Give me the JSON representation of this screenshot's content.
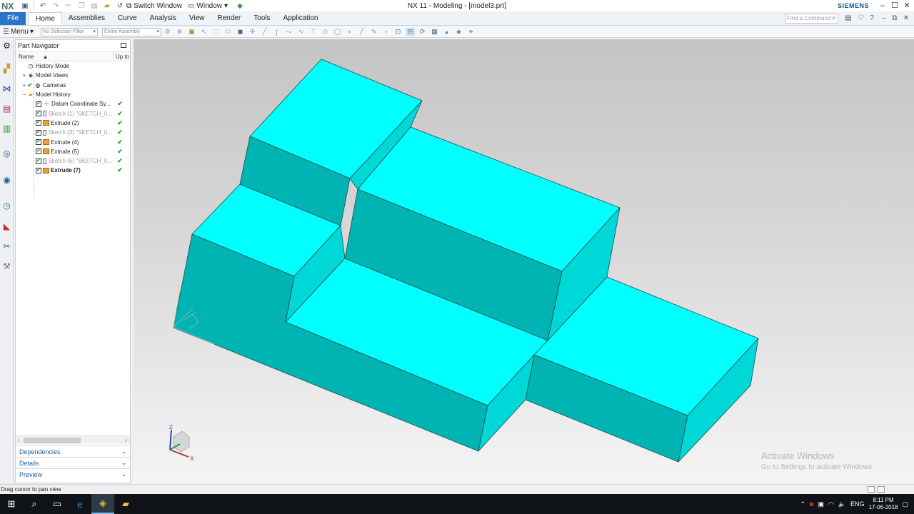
{
  "app": {
    "logo": "NX",
    "window_title": "NX 11 - Modeling - [model3.prt]",
    "brand": "SIEMENS",
    "switch_window": "Switch Window",
    "window_menu": "Window"
  },
  "ribbon": {
    "tabs": [
      "File",
      "Home",
      "Assemblies",
      "Curve",
      "Analysis",
      "View",
      "Render",
      "Tools",
      "Application"
    ],
    "active_tab": "Home",
    "find_placeholder": "Find a Command"
  },
  "toolbar": {
    "menu_label": "Menu",
    "selection_filter": "No Selection Filter",
    "scope": "Entire Assembly"
  },
  "part_navigator": {
    "title": "Part Navigator",
    "columns": {
      "name": "Name",
      "up_to_date": "Up to"
    },
    "nodes": [
      {
        "label": "History Mode",
        "icon": "clock-icon",
        "expander": "",
        "checked": false,
        "status": "",
        "style": "normal"
      },
      {
        "label": "Model Views",
        "icon": "views-icon",
        "expander": "+",
        "checked": false,
        "status": "",
        "style": "normal"
      },
      {
        "label": "Cameras",
        "icon": "camera-icon",
        "expander": "+",
        "checked": true,
        "status": "",
        "style": "normal"
      },
      {
        "label": "Model History",
        "icon": "folder-icon",
        "expander": "−",
        "checked": false,
        "status": "",
        "style": "normal"
      },
      {
        "label": "Datum Coordinate Sy...",
        "icon": "datum-icon",
        "expander": "",
        "checked": true,
        "status": "✔",
        "style": "normal"
      },
      {
        "label": "Sketch (1) \"SKETCH_0...",
        "icon": "sketch-icon",
        "expander": "",
        "checked": true,
        "status": "✔",
        "style": "dim"
      },
      {
        "label": "Extrude (2)",
        "icon": "extrude-icon",
        "expander": "",
        "checked": true,
        "status": "✔",
        "style": "normal"
      },
      {
        "label": "Sketch (3) \"SKETCH_0...",
        "icon": "sketch-icon",
        "expander": "",
        "checked": true,
        "status": "✔",
        "style": "dim"
      },
      {
        "label": "Extrude (4)",
        "icon": "extrude-icon",
        "expander": "",
        "checked": true,
        "status": "✔",
        "style": "normal"
      },
      {
        "label": "Extrude (5)",
        "icon": "extrude-icon",
        "expander": "",
        "checked": true,
        "status": "✔",
        "style": "normal"
      },
      {
        "label": "Sketch (6) \"SKETCH_0...",
        "icon": "sketch-icon",
        "expander": "",
        "checked": true,
        "status": "✔",
        "style": "dim"
      },
      {
        "label": "Extrude (7)",
        "icon": "extrude-icon",
        "expander": "",
        "checked": true,
        "status": "✔",
        "style": "bold"
      }
    ],
    "sections": [
      "Dependencies",
      "Details",
      "Preview"
    ]
  },
  "graphics": {
    "model_colors": {
      "top": "#00FFFF",
      "front": "#00B4B4",
      "side": "#00D8D8",
      "edge": "#1E4A4A"
    },
    "triad_labels": {
      "x": "X",
      "z": "Z"
    }
  },
  "watermark": {
    "line1": "Activate Windows",
    "line2": "Go to Settings to activate Windows."
  },
  "status_bar": {
    "message": "Drag cursor to pan view"
  },
  "taskbar": {
    "language": "ENG",
    "time": "8:11 PM",
    "date": "17-06-2018"
  }
}
